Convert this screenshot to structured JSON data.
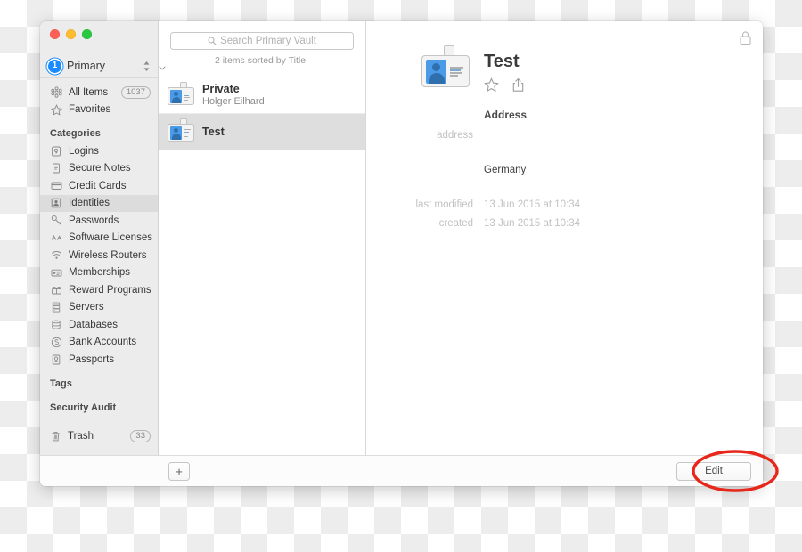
{
  "app": {
    "window_controls": [
      "close",
      "minimize",
      "zoom"
    ]
  },
  "sidebar": {
    "vault": {
      "name": "Primary",
      "logo_icon": "onepassword-logo-icon",
      "stepper_icon": "vault-stepper-icon"
    },
    "quick_items": [
      {
        "label": "All Items",
        "icon": "all-items-icon",
        "count": "1037"
      },
      {
        "label": "Favorites",
        "icon": "star-icon",
        "count": ""
      }
    ],
    "categories_header": "Categories",
    "categories": [
      {
        "label": "Logins",
        "icon": "login-icon"
      },
      {
        "label": "Secure Notes",
        "icon": "note-icon"
      },
      {
        "label": "Credit Cards",
        "icon": "credit-card-icon"
      },
      {
        "label": "Identities",
        "icon": "identity-icon"
      },
      {
        "label": "Passwords",
        "icon": "key-icon"
      },
      {
        "label": "Software Licenses",
        "icon": "license-icon"
      },
      {
        "label": "Wireless Routers",
        "icon": "wifi-icon"
      },
      {
        "label": "Memberships",
        "icon": "membership-card-icon"
      },
      {
        "label": "Reward Programs",
        "icon": "reward-icon"
      },
      {
        "label": "Servers",
        "icon": "server-icon"
      },
      {
        "label": "Databases",
        "icon": "database-icon"
      },
      {
        "label": "Bank Accounts",
        "icon": "bank-icon"
      },
      {
        "label": "Passports",
        "icon": "passport-icon"
      }
    ],
    "selected_category": "Identities",
    "tags_header": "Tags",
    "security_audit_header": "Security Audit",
    "trash": {
      "label": "Trash",
      "icon": "trash-icon",
      "count": "33"
    }
  },
  "list": {
    "search": {
      "placeholder": "Search Primary Vault",
      "value": "",
      "icon": "search-icon"
    },
    "sort_label": "2 items sorted by Title",
    "sort_chevron_icon": "chevron-down-icon",
    "items": [
      {
        "title": "Private",
        "subtitle": "Holger Eilhard",
        "icon": "identity-card-icon",
        "selected": false
      },
      {
        "title": "Test",
        "subtitle": "",
        "icon": "identity-card-icon",
        "selected": true
      }
    ]
  },
  "detail": {
    "lock_icon": "lock-icon",
    "item_icon": "identity-card-icon",
    "title": "Test",
    "favorite_icon": "star-icon",
    "share_icon": "share-icon",
    "section_title": "Address",
    "fields": [
      {
        "label": "address",
        "value": ""
      },
      {
        "label": "",
        "value": "Germany"
      }
    ],
    "meta": [
      {
        "label": "last modified",
        "value": "13 Jun 2015 at 10:34"
      },
      {
        "label": "created",
        "value": "13 Jun 2015 at 10:34"
      }
    ]
  },
  "bottom_bar": {
    "add_label": "+",
    "add_icon": "plus-icon",
    "edit_label": "Edit"
  },
  "annotation": {
    "shape": "ellipse",
    "color": "#e8271b",
    "target": "Edit"
  }
}
